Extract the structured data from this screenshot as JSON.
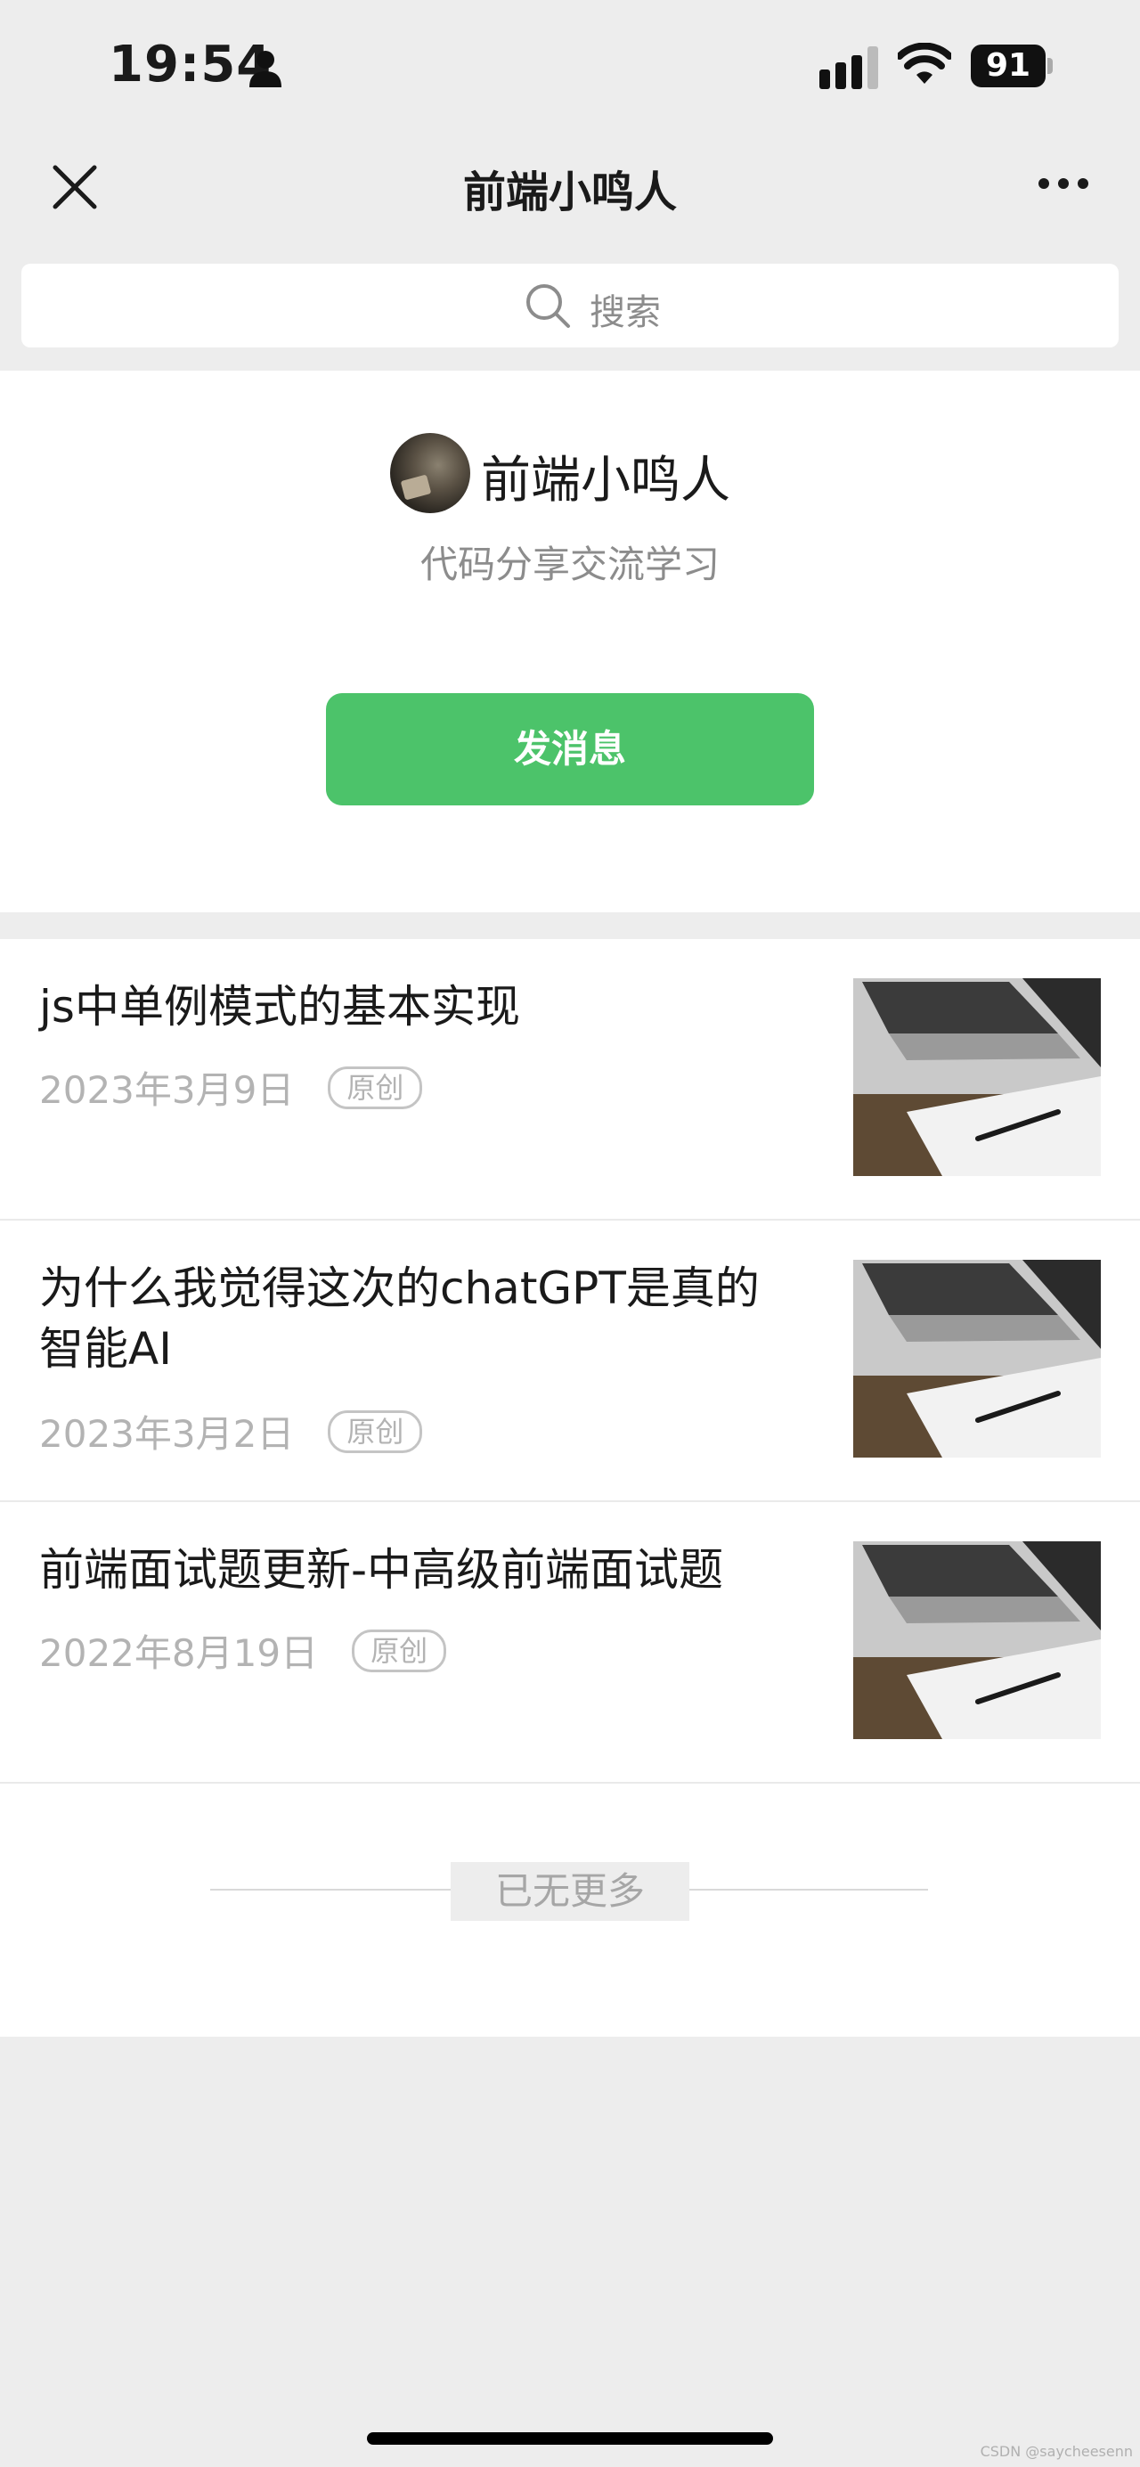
{
  "status_bar": {
    "time": "19:54",
    "battery": "91"
  },
  "nav": {
    "title": "前端小鸣人"
  },
  "search": {
    "placeholder": "搜索"
  },
  "profile": {
    "name": "前端小鸣人",
    "description": "代码分享交流学习",
    "message_button": "发消息"
  },
  "articles": [
    {
      "title": "js中单例模式的基本实现",
      "date": "2023年3月9日",
      "badge": "原创"
    },
    {
      "title": "为什么我觉得这次的chatGPT是真的智能AI",
      "date": "2023年3月2日",
      "badge": "原创"
    },
    {
      "title": "前端面试题更新-中高级前端面试题",
      "date": "2022年8月19日",
      "badge": "原创"
    }
  ],
  "end_text": "已无更多",
  "watermark": "CSDN @saycheesenn",
  "colors": {
    "accent_green": "#4cc36a",
    "background": "#ededed"
  }
}
